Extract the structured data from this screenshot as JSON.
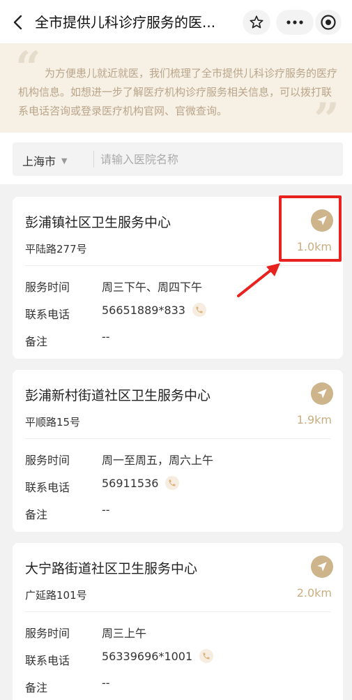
{
  "header": {
    "title": "全市提供儿科诊疗服务的医..."
  },
  "notice": {
    "text": "为方便患儿就近就医，我们梳理了全市提供儿科诊疗服务的医疗机构信息。如想进一步了解医疗机构诊疗服务相关信息，可以拨打联系电话咨询或登录医疗机构官网、官微查询。"
  },
  "search": {
    "city": "上海市",
    "placeholder": "请输入医院名称",
    "value": ""
  },
  "labels": {
    "hours": "服务时间",
    "phone": "联系电话",
    "remark": "备注"
  },
  "hospitals": [
    {
      "name": "彭浦镇社区卫生服务中心",
      "address": "平陆路277号",
      "distance": "1.0km",
      "hours": "周三下午、周四下午",
      "phone": "56651889*833",
      "remark": "--"
    },
    {
      "name": "彭浦新村街道社区卫生服务中心",
      "address": "平顺路15号",
      "distance": "1.9km",
      "hours": "周一至周五，周六上午",
      "phone": "56911536",
      "remark": "--"
    },
    {
      "name": "大宁路街道社区卫生服务中心",
      "address": "广延路101号",
      "distance": "2.0km",
      "hours": "周三上午",
      "phone": "56339696*1001",
      "remark": "--"
    }
  ],
  "colors": {
    "accent": "#cdb48b",
    "distance": "#c9ad80",
    "annotation": "#e8231f",
    "notice_bg": "#f7f0e4"
  }
}
